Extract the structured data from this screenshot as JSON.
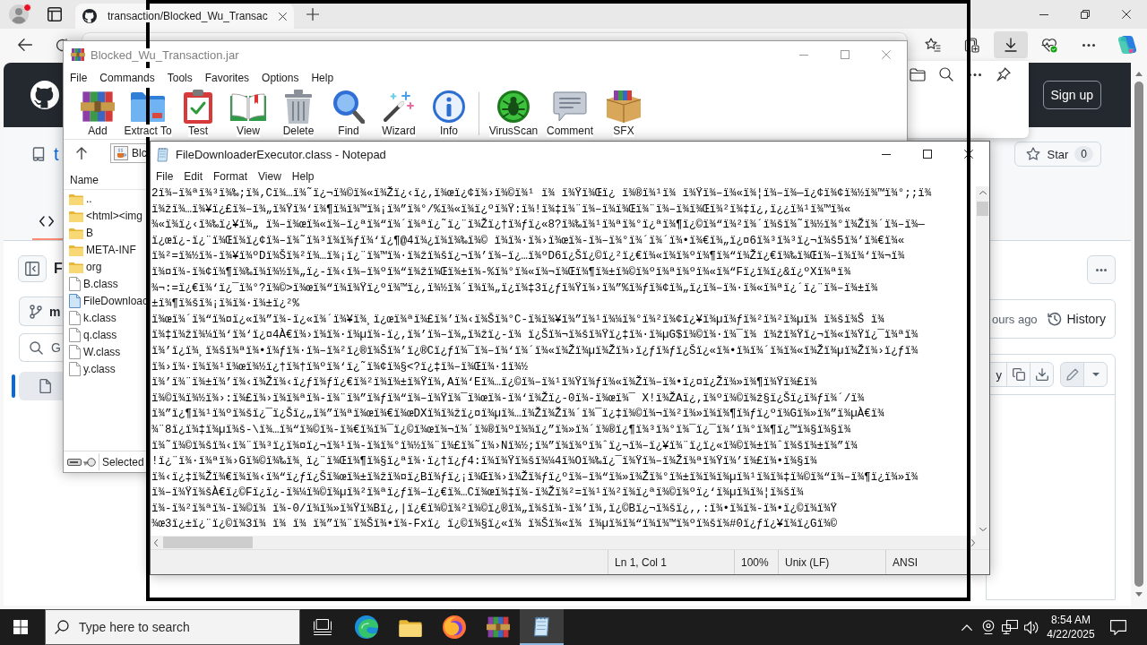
{
  "browser": {
    "tabs": [
      {
        "title": "transaction/Blocked_Wu_Transac",
        "selected": true
      }
    ],
    "toolbar_buttons": [
      {
        "kind": "favorites",
        "selected": false
      },
      {
        "kind": "collections",
        "selected": false
      },
      {
        "kind": "downloads",
        "selected": true
      },
      {
        "kind": "performance",
        "selected": false
      },
      {
        "kind": "more",
        "selected": false
      },
      {
        "kind": "copilot",
        "selected": false
      }
    ],
    "downloads_panel": {
      "buttons": [
        {
          "kind": "folder"
        },
        {
          "kind": "search"
        },
        {
          "kind": "more"
        },
        {
          "kind": "pin"
        }
      ]
    }
  },
  "github": {
    "header": {
      "button": "Sign up"
    },
    "repo": {
      "name": "t",
      "star_label": "Star",
      "star_count": "0"
    },
    "sidebar": {
      "title": "F",
      "branch": "m",
      "search": {
        "placeholder": "G"
      },
      "files": [
        {
          "selected": true
        }
      ]
    },
    "commit": {
      "time": "ours ago",
      "history": "History"
    },
    "file_toolbar": {
      "button": "y"
    }
  },
  "winrar": {
    "title": "Blocked_Wu_Transaction.jar",
    "menu": [
      "File",
      "Commands",
      "Tools",
      "Favorites",
      "Options",
      "Help"
    ],
    "toolbar": [
      {
        "kind": "add",
        "label": "Add"
      },
      {
        "kind": "extract",
        "label": "Extract To"
      },
      {
        "kind": "test",
        "label": "Test"
      },
      {
        "kind": "view",
        "label": "View"
      },
      {
        "kind": "delete",
        "label": "Delete"
      },
      {
        "kind": "find",
        "label": "Find"
      },
      {
        "kind": "wizard",
        "label": "Wizard"
      },
      {
        "kind": "info",
        "label": "Info"
      },
      {
        "kind": "separator"
      },
      {
        "kind": "virusscan",
        "label": "VirusScan"
      },
      {
        "kind": "comment",
        "label": "Comment"
      },
      {
        "kind": "sfx",
        "label": "SFX"
      }
    ],
    "path": "Blc",
    "columns": [
      "Name"
    ],
    "files": [
      {
        "name": "..",
        "kind": "folder",
        "selected": false
      },
      {
        "name": "<html><img",
        "kind": "folder",
        "selected": false
      },
      {
        "name": "B",
        "kind": "folder",
        "selected": false
      },
      {
        "name": "META-INF",
        "kind": "folder",
        "selected": false
      },
      {
        "name": "org",
        "kind": "folder",
        "selected": false
      },
      {
        "name": "B.class",
        "kind": "file",
        "selected": false
      },
      {
        "name": "FileDownloac",
        "kind": "file",
        "selected": true
      },
      {
        "name": "k.class",
        "kind": "file",
        "selected": false
      },
      {
        "name": "q.class",
        "kind": "file",
        "selected": false
      },
      {
        "name": "W.class",
        "kind": "file",
        "selected": false
      },
      {
        "name": "y.class",
        "kind": "file",
        "selected": false
      }
    ],
    "status": "Selected"
  },
  "notepad": {
    "title": "FileDownloaderExecutor.class - Notepad",
    "menu": [
      "File",
      "Edit",
      "Format",
      "View",
      "Help"
    ],
    "lines": [
      "2ï¾–ï¾ªï¾³ï¾‰;ï¾‚Cï¾…ï¾˜ï¿¬ï¾©ï¾«ï¾Žï¿‹ï¿‚ï¾œï¿¢ï¾›ï¾©ï¾¹ ï¾ ï¾Ÿï¾Œï¿ ï¾®ï¾¹ï¾ ï¾Ÿï¾–ï¾«ï¾¦ï¾–ï¾—ï¿¢ï¾¢ï¾½ï¾™ï¾°;;ï¾",
      "ï¾žï¾…ï¾¥ï¿£ï¾–ï¾„ï¾Ÿï¾‘ï¾¶ï¾ï¾™ï¾¡ï¾”ï¾°/%ï¾«ï¾ï¿ºï¾Ÿ:ï¾!ï¾‡ï¾¨ï¾–ï¾ï¾Œï¾¨ï¾–ï¾ï¾Œï¾²ï¾‡ï¿‚ï¿¿ï¾¹ï¾™ï¾«",
      "¾«ï¾ï¿‹ï¾‰ï¿¥ï¾„ ï¾–ï¾œï¾«ï¾–ï¿ªï¾“ï¾´ï¾ªï¿˜ï¿¨ï¾Žï¿†ï¾ƒï¿«8?ï¾‰ï¾¹ï¾ªï¾°ï¿ªï¾¶ï¿©ï¾“ï¾²ï¾´ï¾šï¾˜ï¾½ï¾°ï¾Žï¾´ï¾–ï¾—",
      "ï¿œï¿-ï¿¨ï¾Œï¾ï¿¢ï¾–ï¾˜ï¾³ï¾ï¾ƒï¾‘ï¿¶@4ï¾¿ï¾ï¾‰ï¾© ï¾ï¾·ï¾›ï¾œï¾-ï¾–ï¾°ï¾´ï¾´ï¾•ï¾€ï¾„ï¿¤6ï¾³ï¾³ï¿¬ï¾š5ï¾’ï¾€ï¾«",
      "ï¾²=ï¾½ï¾-ï¾¥ï¾ºDï¾Šï¾²ï¾…ï¾¡ï¿¨ï¾™ï¾·ï¾žï¾šï¿¬ï¾’ï¾–ï¿…ï¾ºD6ï¿Šï¿©ï¿²ï¿€ï¾«ï¾ï¾ºï¾¶ï¾“ï¾Žï¿€ï¾‰ï¾Œï¾–ï¾ï¾‘ï¾¬ï¾",
      "ï¾¤ï¾-ï¾¢ï¾¶ï¾‰ï¾ï¾½ï¾„ï¿-ï¾‹ï¾–ï¾ºï¾“ï¾žï¾Œï¾±ï¾-%ï¾°ï¾«ï¾¬ï¾Œï¾¶ï¾±ï¾©ï¾ºï¾ªï¾ºï¾«ï¾“Fï¿ï¾ï¿&ï¿ºXï¾ªï¾",
      "¾¬:=ï¿€ï¾‘ï¿¯ï¾°?ï¾©>ï¾œï¾“ï¾ï¾Ÿï¿ºï¾™ï¿‚ï¾½ï¾´ï¾ï¾„ï¿ï¾‡3ï¿ƒï¾Ÿï¾›ï¾”%ï¾ƒï¾¢ï¾„ï¿ï¾–ï¾·ï¾«ï¾ªï¿´ï¿¨ï¾–ï¾±ï¾",
      "±ï¾¶ï¾šï¾¡ï¾ï¾·ï¾±ï¿²%",
      "ï¾œï¾´ï¾“ï¾¤ï¿«ï¾”ï¾-ï¿«ï¾´ï¾¥ï¾¸ï¿œï¾ªï¾£ï¾’ï¾‹ï¾Šï¾°C-ï¾ï¾¥ï¾”ï¾¹ï¾¼ï¾°ï¾²ï¾¢ï¿¥ï¾µï¾ƒï¾²ï¾²ï¾µï¾ ï¾šï¾Š ï¾",
      "ï¾‡ï¾žï¾¼ï¾‘ï¾‘ï¿¤4À€ï¾›ï¾ï¾·ï¾µï¾-ï¿‚ï¾’ï¾–ï¾„ï¾žï¿-ï¾ ï¿Šï¾¬ï¾šï¾Ÿï¿‡ï¾·ï¾µG$ï¾©ï¾·ï¾¯ï¾ ï¾žï¾Ÿï¿¬ï¾«ï¾Ÿï¿¯ï¾ªï¾",
      "ï¾’ï¿ï¾¸ï¾šï¾ªï¾•ï¾ƒï¾·ï¾–ï¾²ï¿®ï¾Šï¾’ï¿®Cï¿ƒï¾¯ï¾–ï¾‘ï¾´ï¾«ï¾Žï¾µï¾Žï¾›ï¿ƒï¾ƒï¿Šï¿«ï¾•ï¾ï¾´ï¾ï¾«ï¾Žï¾µï¾Žï¾›ï¿ƒï¾",
      "ï¾›ï¾·ï¾ï¾¹ï¾œï¾½ï¿†ï¾†ï¾ºï¾‘ï¿˜ï¾¢ï¾§<?ï¿‡ï¾–ï¾Œï¾·1ï¾½",
      "ï¾’ï¾¨ï¾±ï¾’ï¾‹ï¾Žï¾‹ï¿ƒï¾ƒï¿€ï¾²ï¾ï¾±ï¾Ÿï¾,Aï¾‘Eï¾…ï¿©ï¾–ï¾¹ï¾Ÿï¾ƒï¾«ï¾Žï¾–ï¾•ï¿¤ï¿Žï¾»ï¾¶ï¾Ÿï¾£ï¾",
      "ï¾©ï¾ï¾½ï¾›:ï¾£ï¾›ï¾ï¾ªï¾-ï¾¨ï¾”ï¾ƒï¾“ï¾–ï¾Ÿï¾¯ï¾œï¾-ï¾‘ï¾Žï¿-0ï¾-ï¾œï¾¯ X!ï¾ŽAï¿‚ï¾ºï¾©ï¾ž§ï¿Šï¿ï¾ƒï¾´/ï¾",
      "ï¾”ï¿¶ï¾¹ï¾ºï¾šï¿¯ï¿Šï¿„ï¾”ï¾ªï¾œï¾€ï¾œDXï¾ï¾žï¿¤ï¾µï¾…ï¾Žï¾Žï¾´ï¾¯ï¿‡ï¾©ï¾¬ï¾²ï¾»ï¾ï¾¶ï¾ƒï¿ºï¾Gï¾»ï¾”ï¾µÀ€ï¾",
      "¾¨8ï¿ï¾‡ï¾µï¾š-\\ï¾…ï¾“ï¾©ï¾-ï¾€ï¾ï¾¯ï¿©ï¾œï¾¬ï¾´ï¾®ï¾ºï¾¾ï¿”ï¾»ï¾´ï¾®ï¿¶ï¾³ï¾°ï¾¯ï¿¯ï¾’ï¾°ï¾¶ï¿™ï¾§ï¾§ï¾",
      "ï¾˜ï¾©ï¾šï¾‹ï¾¨ï¾³ï¿ï¾¤ï¿¬ï¾¹ï¾-ï¾ï¾°ï¾½ï¾¨ï¾£ï¾˜ï¾›Nï¾½;ï¾”ï¾ï¾ºï¾ˆï¿¬ï¾–ï¿¥ï¾¨ï¿ï¿«ï¾©ï¾±ï¾ˆï¾šï¾±ï¾”ï¾",
      "!ï¿¨ï¾·ï¾ªï¾›Gï¾©ï¾‰ï¾¸ï¿¨ï¾Œï¾¶ï¾§ï¿ªï¾·ï¿†ï¿ƒ4:ï¾ï¾Ÿï¾šï¾¼4ï¾Oï¾‰ï¿¯ï¾Ÿï¾–ï¾Žï¾ªï¾Ÿï¾’ï¾£ï¾•ï¾§ï¾",
      "ï¾‹ï¿‡ï¾Žï¾€ï¾ï¾‹ï¾“ï¿ƒï¿Šï¾œï¾±ï¾žï¾¤ï¿Bï¾ƒï¿¡ï¾Œï¾›ï¾Žï¾ƒï¿ºï¾–ï¾“ï¾»ï¾Žï¾°ï¾±ï¾ï¾ï¾µï¾¹ï¾ï¾‡ï¾©ï¾“ï¾–ï¾¶ï¿ï¾»ï¾",
      "ï¾–ï¾Ÿï¾šÀ€ï¿©Fï¿ï¿-ï¾¼ï¾©ï¾µï¾²ï¾ªï¿ƒï¾–ï¿€ï¾…Cï¾œï¾‡ï¾-ï¾Žï¾²=ï¾¹ï¾²ï¾ï¿ªï¾©ï¾ºï¿‘ï¾µï¾ï¾¦ï¾šï¾",
      "ï¾-ï¾²ï¾ªï¾-ï¾©ï¾ ï¾-0/ï¾ï¾»ï¾Ÿï¾Bï¿‚|ï¿€ï¾©ï¾²ï¾©ï¿®ï¾„ï¾šï¾-ï¾’ï¾‚ï¿©Bï¿¬ï¾šï¿‚,:ï¾•ï¾ï¾-ï¾•ï¿©ï¾ï¾Ÿ",
      "¾œ3ï¿±ï¿¨ï¿©ï¾3ï¾ ï¾ ï¾ ï¾”ï¾¨ï¾Šï¾•ï¾-Fxï¿ ï¿©ï¾§ï¿«ï¾ ï¾Šï¾«ï¾ ï¾µï¾ï¾“ï¾ï¾™ï¾ºï¾šï¾#0ï¿ƒï¿¥ï¾ï¿Gï¾©"
    ],
    "status": [
      "Ln 1, Col 1",
      "100%",
      "Unix (LF)",
      "ANSI"
    ]
  },
  "taskbar": {
    "search": {
      "placeholder": "Type here to search"
    },
    "apps": [
      {
        "kind": "task-view",
        "selected": false
      },
      {
        "kind": "edge",
        "selected": false
      },
      {
        "kind": "explorer",
        "selected": false
      },
      {
        "kind": "firefox",
        "selected": false
      },
      {
        "kind": "winrar",
        "selected": false
      },
      {
        "kind": "notepad",
        "selected": true
      }
    ],
    "time": "8:54 AM",
    "date": "4/22/2025"
  }
}
